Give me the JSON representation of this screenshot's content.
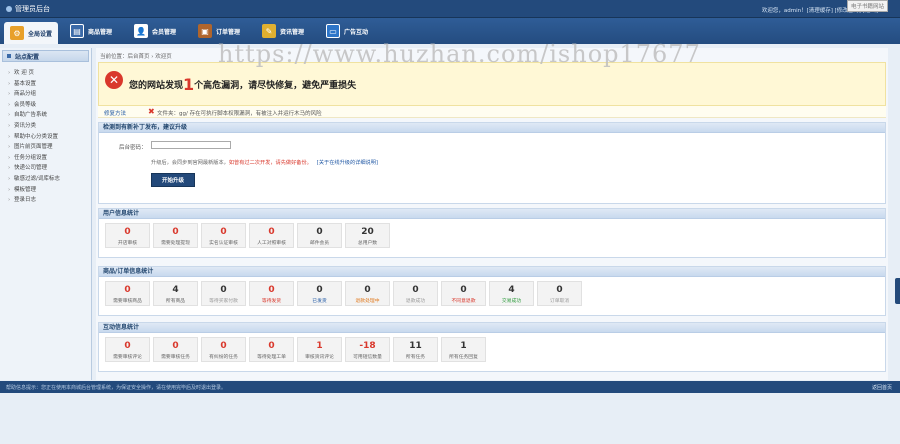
{
  "app_title": "管理员后台",
  "topbar": {
    "user_info": "欢迎您，admin！[清理缓存] [修改密码] [退出]",
    "watermark_label": "电子书籍网站"
  },
  "nav": [
    {
      "label": "全局设置",
      "icon": "settings-icon",
      "color": "#e8a02a"
    },
    {
      "label": "商品管理",
      "icon": "product-icon",
      "color": "#3b6aa8"
    },
    {
      "label": "会员管理",
      "icon": "member-icon",
      "color": "#4a7fc1"
    },
    {
      "label": "订单管理",
      "icon": "order-icon",
      "color": "#b0652c"
    },
    {
      "label": "资讯管理",
      "icon": "news-icon",
      "color": "#e0b030"
    },
    {
      "label": "广告互动",
      "icon": "ads-icon",
      "color": "#2d75c8"
    }
  ],
  "watermark": "https://www.huzhan.com/ishop17677",
  "sidebar": {
    "header": "站点配置",
    "items": [
      "欢 迎 页",
      "基本设置",
      "商品分组",
      "会员等级",
      "自助广告系统",
      "资讯分类",
      "帮助中心分类设置",
      "图片前页面管理",
      "任务分组设置",
      "快递公司管理",
      "敏感过滤/词库标志",
      "模板管理",
      "登录日志"
    ]
  },
  "breadcrumb": "当前位置：后台首页 › 欢迎页",
  "alert": {
    "pre": "您的网站发现",
    "count": "1",
    "post": "个高危漏洞，请尽快修复，避免严重损失",
    "fix_link": "修复方法",
    "fix_text": "文件夹：gg/ 存在可执行脚本权限漏洞，有被注入并运行木马的风险"
  },
  "upgrade": {
    "title": "检测到有新补丁发布，建议升级",
    "password_label": "后台密码：",
    "note_pre": "升级后，会同步到官网最新版本，",
    "note_red": "如曾有过二次开发，请先做好备份。",
    "note_link": "[关于在线升级的详细说明]",
    "button": "开始升级"
  },
  "user_stats": {
    "title": "用户信息统计",
    "cards": [
      {
        "num": "0",
        "label": "开店审核",
        "red": true
      },
      {
        "num": "0",
        "label": "需要处理提现",
        "red": true
      },
      {
        "num": "0",
        "label": "实名认证审核",
        "red": true
      },
      {
        "num": "0",
        "label": "人工对照审核",
        "red": true
      },
      {
        "num": "0",
        "label": "邮件会员",
        "red": false
      },
      {
        "num": "20",
        "label": "总用户数",
        "red": false
      }
    ]
  },
  "order_stats": {
    "title": "商品/订单信息统计",
    "cards": [
      {
        "num": "0",
        "label": "需要审核商品",
        "red": true,
        "label_color": "#666"
      },
      {
        "num": "4",
        "label": "所有商品",
        "red": false,
        "label_color": "#666"
      },
      {
        "num": "0",
        "label": "等待买家付款",
        "red": false,
        "label_color": "#999"
      },
      {
        "num": "0",
        "label": "等待发货",
        "red": true,
        "label_color": "#d9382c"
      },
      {
        "num": "0",
        "label": "已发货",
        "red": false,
        "label_color": "#1f57a4"
      },
      {
        "num": "0",
        "label": "退款处理中",
        "red": false,
        "label_color": "#e07a1f"
      },
      {
        "num": "0",
        "label": "退款成功",
        "red": false,
        "label_color": "#999"
      },
      {
        "num": "0",
        "label": "不同意退款",
        "red": false,
        "label_color": "#d9382c"
      },
      {
        "num": "4",
        "label": "交易成功",
        "red": false,
        "label_color": "#2b9a3a"
      },
      {
        "num": "0",
        "label": "订单取消",
        "red": false,
        "label_color": "#999"
      }
    ]
  },
  "interact_stats": {
    "title": "互动信息统计",
    "cards": [
      {
        "num": "0",
        "label": "需要审核评论",
        "red": true
      },
      {
        "num": "0",
        "label": "需要审核任务",
        "red": true
      },
      {
        "num": "0",
        "label": "有纠纷的任务",
        "red": true
      },
      {
        "num": "0",
        "label": "等待处理工单",
        "red": true
      },
      {
        "num": "1",
        "label": "审核资讯评论",
        "red": true
      },
      {
        "num": "-18",
        "label": "可用短信数量",
        "red": true
      },
      {
        "num": "11",
        "label": "所有任务",
        "red": false
      },
      {
        "num": "1",
        "label": "所有任务回复",
        "red": false
      }
    ]
  },
  "footer": {
    "text": "帮助信息提示：您正在使用本商城后台管理系统，为保证安全操作，请在使用完毕后及时退出登录。",
    "back": "返回首页"
  }
}
